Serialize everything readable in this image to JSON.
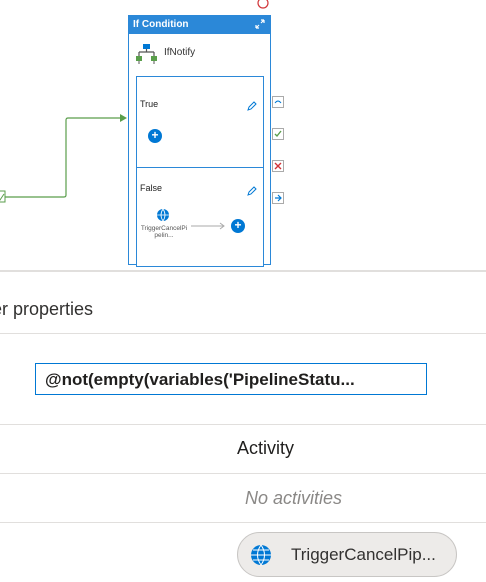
{
  "canvas": {
    "if_condition": {
      "title": "If Condition",
      "activity_name": "IfNotify",
      "true_branch": {
        "label": "True"
      },
      "false_branch": {
        "label": "False",
        "activity_label": "TriggerCancelPipelin..."
      }
    }
  },
  "properties": {
    "title": "er properties",
    "expression_value": "@not(empty(variables('PipelineStatu...",
    "column_header": "Activity",
    "true_row": {
      "empty_text": "No activities"
    },
    "false_row": {
      "activity_chip": "TriggerCancelPip..."
    }
  },
  "colors": {
    "accent": "#0078d4",
    "header_blue": "#2b88d8",
    "connector_green": "#5a9e4b",
    "fail_red": "#d13438"
  },
  "icons": [
    "expand-icon",
    "pencil-icon",
    "plus-icon",
    "globe-icon",
    "check-icon",
    "close-icon",
    "arrow-icon",
    "pipeline-icon"
  ]
}
